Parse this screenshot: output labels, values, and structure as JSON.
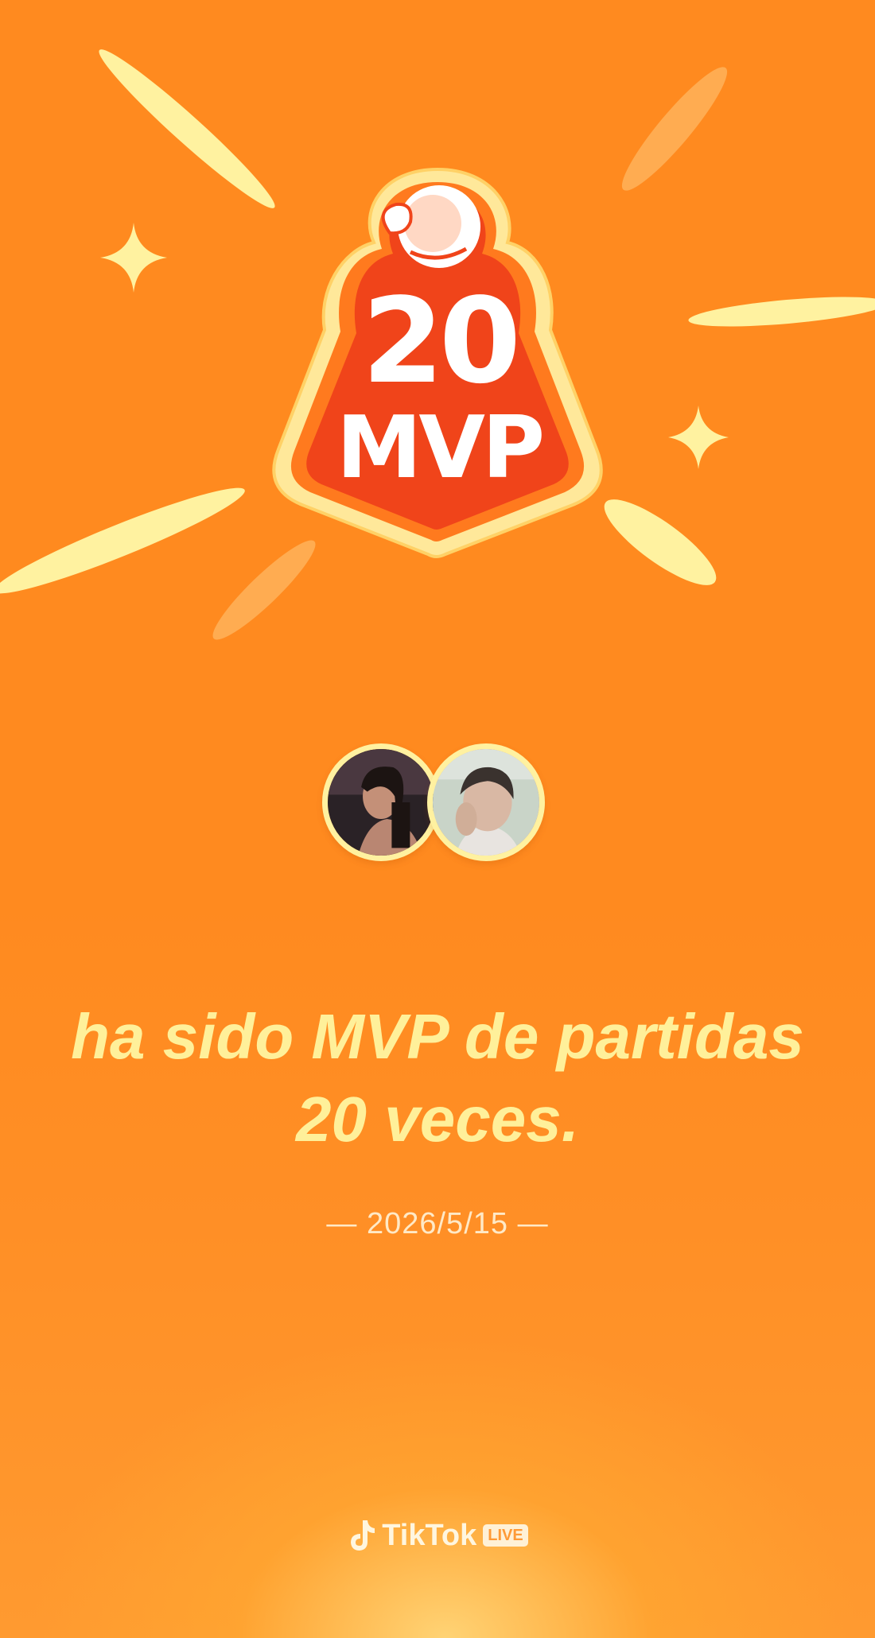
{
  "badge": {
    "count": "20",
    "title": "MVP"
  },
  "achievement": {
    "line1": "ha sido MVP de partidas",
    "line2": "20 veces."
  },
  "date": "— 2026/5/15 —",
  "brand": {
    "name": "TikTok",
    "live_label": "LIVE"
  },
  "colors": {
    "background": "#FF8A1F",
    "headline": "#FFF09A",
    "badge_red": "#F0441A",
    "badge_border": "#FFE27A"
  },
  "icons": [
    "spark-icon",
    "tiktok-note-icon"
  ]
}
